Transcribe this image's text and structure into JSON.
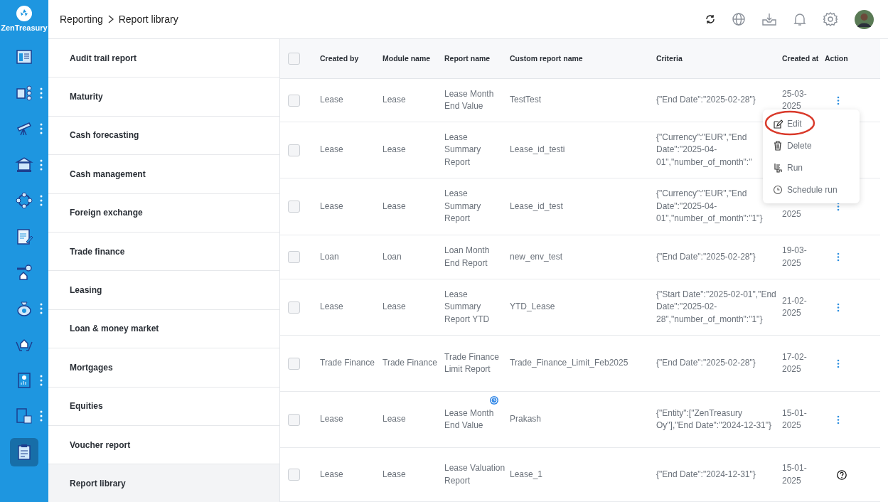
{
  "brand": {
    "name": "ZenTreasury"
  },
  "rail": [
    {
      "submenu": false,
      "selected": false
    },
    {
      "submenu": true,
      "selected": false
    },
    {
      "submenu": true,
      "selected": false
    },
    {
      "submenu": true,
      "selected": false
    },
    {
      "submenu": true,
      "selected": false
    },
    {
      "submenu": false,
      "selected": false
    },
    {
      "submenu": false,
      "selected": false
    },
    {
      "submenu": true,
      "selected": false
    },
    {
      "submenu": false,
      "selected": false
    },
    {
      "submenu": true,
      "selected": false
    },
    {
      "submenu": true,
      "selected": false
    },
    {
      "submenu": false,
      "selected": true
    }
  ],
  "breadcrumb": [
    "Reporting",
    "Report library"
  ],
  "menu": [
    {
      "label": "Audit trail report",
      "selected": false
    },
    {
      "label": "Maturity",
      "selected": false
    },
    {
      "label": "Cash forecasting",
      "selected": false
    },
    {
      "label": "Cash management",
      "selected": false
    },
    {
      "label": "Foreign exchange",
      "selected": false
    },
    {
      "label": "Trade finance",
      "selected": false
    },
    {
      "label": "Leasing",
      "selected": false
    },
    {
      "label": "Loan & money market",
      "selected": false
    },
    {
      "label": "Mortgages",
      "selected": false
    },
    {
      "label": "Equities",
      "selected": false
    },
    {
      "label": "Voucher report",
      "selected": false
    },
    {
      "label": "Report library",
      "selected": true
    }
  ],
  "table": {
    "all_checked": false,
    "columns": [
      "Created by",
      "Module name",
      "Report name",
      "Custom report name",
      "Criteria",
      "Created at",
      "Action"
    ],
    "rows": [
      {
        "kind": "menu",
        "created_by": "Lease",
        "module": "Lease",
        "report": "Lease Month End Value",
        "custom": "TestTest",
        "criteria": "{\"End Date\":\"2025-02-28\"}",
        "created_at": "25-03-2025",
        "checked": false
      },
      {
        "kind": "covered",
        "created_by": "Lease",
        "module": "Lease",
        "report": "Lease Summary Report",
        "custom": "Lease_id_testi",
        "criteria": "{\"Currency\":\"EUR\",\"End Date\":\"2025-04-01\",\"number_of_month\":\"",
        "checked": false
      },
      {
        "kind": "menu",
        "created_by": "Lease",
        "module": "Lease",
        "report": "Lease Summary Report",
        "custom": "Lease_id_test",
        "criteria": "{\"Currency\":\"EUR\",\"End Date\":\"2025-04-01\",\"number_of_month\":\"1\"}",
        "created_at": "2025",
        "checked": false
      },
      {
        "kind": "menu",
        "created_by": "Loan",
        "module": "Loan",
        "report": "Loan Month End Report",
        "custom": "new_env_test",
        "criteria": "{\"End Date\":\"2025-02-28\"}",
        "created_at": "19-03-2025",
        "checked": false
      },
      {
        "kind": "menu",
        "created_by": "Lease",
        "module": "Lease",
        "report": "Lease Summary Report YTD",
        "custom": "YTD_Lease",
        "criteria": "{\"Start Date\":\"2025-02-01\",\"End Date\":\"2025-02-28\",\"number_of_month\":\"1\"}",
        "created_at": "21-02-2025",
        "checked": false
      },
      {
        "kind": "menu",
        "created_by": "Trade Finance",
        "module": "Trade Finance",
        "report": "Trade Finance Limit Report",
        "custom": "Trade_Finance_Limit_Feb2025",
        "criteria": "{\"End Date\":\"2025-02-28\"}",
        "created_at": "17-02-2025",
        "checked": false
      },
      {
        "kind": "menu",
        "created_by": "Lease",
        "module": "Lease",
        "report": "Lease Month End Value",
        "custom": "Prakash",
        "criteria": "{\"Entity\":[\"ZenTreasury Oy\"],\"End Date\":\"2024-12-31\"}",
        "created_at": "15-01-2025",
        "checked": false
      },
      {
        "kind": "help",
        "created_by": "Lease",
        "module": "Lease",
        "report": "Lease Valuation Report",
        "custom": "Lease_1",
        "criteria": "{\"End Date\":\"2024-12-31\"}",
        "created_at": "15-01-2025",
        "checked": false
      }
    ]
  },
  "action_menu": [
    {
      "label": "Edit",
      "circled": true
    },
    {
      "label": "Delete",
      "circled": false
    },
    {
      "label": "Run",
      "circled": false
    },
    {
      "label": "Schedule run",
      "circled": false
    }
  ]
}
